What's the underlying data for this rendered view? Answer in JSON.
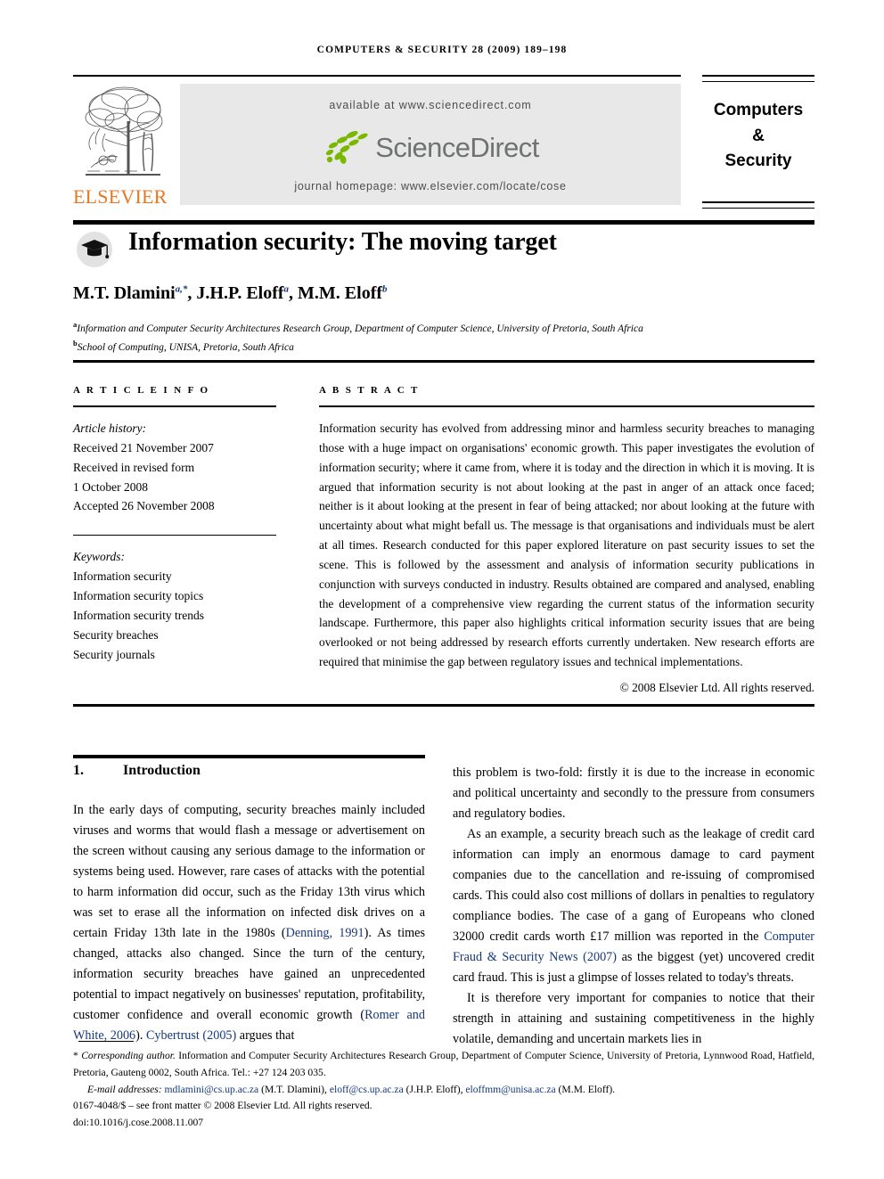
{
  "running_head": "COMPUTERS & SECURITY 28 (2009) 189–198",
  "masthead": {
    "available_at": "available at www.sciencedirect.com",
    "sciencedirect_wordmark": "ScienceDirect",
    "journal_homepage": "journal homepage: www.elsevier.com/locate/cose",
    "publisher_wordmark": "ELSEVIER",
    "publisher_logo_icon": "elsevier-tree-icon",
    "sciencedirect_logo_icon": "sciencedirect-leaves-icon"
  },
  "journal_box": {
    "line1": "Computers",
    "line2": "&",
    "line3": "Security"
  },
  "article": {
    "title": "Information security: The moving target",
    "title_icon": "graduation-cap-icon",
    "authors_plain": "M.T. Dlamini, J.H.P. Eloff, M.M. Eloff",
    "author1": "M.T. Dlamini",
    "author1_sup": "a,*",
    "author2": "J.H.P. Eloff",
    "author2_sup": "a",
    "author3": "M.M. Eloff",
    "author3_sup": "b",
    "affiliation_a_marker": "a",
    "affiliation_a": "Information and Computer Security Architectures Research Group, Department of Computer Science, University of Pretoria, South Africa",
    "affiliation_b_marker": "b",
    "affiliation_b": "School of Computing, UNISA, Pretoria, South Africa"
  },
  "article_info": {
    "label": "A R T I C L E  I N F O",
    "history_label": "Article history:",
    "history": [
      "Received 21 November 2007",
      "Received in revised form",
      "1 October 2008",
      "Accepted 26 November 2008"
    ],
    "keywords_label": "Keywords:",
    "keywords": [
      "Information security",
      "Information security topics",
      "Information security trends",
      "Security breaches",
      "Security journals"
    ]
  },
  "abstract": {
    "label": "A B S T R A C T",
    "text": "Information security has evolved from addressing minor and harmless security breaches to managing those with a huge impact on organisations' economic growth. This paper investigates the evolution of information security; where it came from, where it is today and the direction in which it is moving. It is argued that information security is not about looking at the past in anger of an attack once faced; neither is it about looking at the present in fear of being attacked; nor about looking at the future with uncertainty about what might befall us. The message is that organisations and individuals must be alert at all times. Research conducted for this paper explored literature on past security issues to set the scene. This is followed by the assessment and analysis of information security publications in conjunction with surveys conducted in industry. Results obtained are compared and analysed, enabling the development of a comprehensive view regarding the current status of the information security landscape. Furthermore, this paper also highlights critical information security issues that are being overlooked or not being addressed by research efforts currently undertaken. New research efforts are required that minimise the gap between regulatory issues and technical implementations.",
    "copyright": "© 2008 Elsevier Ltd. All rights reserved."
  },
  "section": {
    "number": "1.",
    "heading": "Introduction"
  },
  "body": {
    "left_p1_part1": "In the early days of computing, security breaches mainly included viruses and worms that would flash a message or advertisement on the screen without causing any serious damage to the information or systems being used. However, rare cases of attacks with the potential to harm information did occur, such as the Friday 13th virus which was set to erase all the information on infected disk drives on a certain Friday 13th late in the 1980s (",
    "cite_denning": "Denning, 1991",
    "left_p1_part2": "). As times changed, attacks also changed. Since the turn of the century, information security breaches have gained an unprecedented potential to impact negatively on businesses' reputation, profitability, customer confidence and overall economic growth (",
    "cite_romer": "Romer and White, 2006",
    "left_p1_part3": "). ",
    "cite_cybertrust": "Cybertrust (2005)",
    "left_p1_part4": " argues that",
    "right_p1": "this problem is two-fold: firstly it is due to the increase in economic and political uncertainty and secondly to the pressure from consumers and regulatory bodies.",
    "right_p2_part1": "As an example, a security breach such as the leakage of credit card information can imply an enormous damage to card payment companies due to the cancellation and re-issuing of compromised cards. This could also cost millions of dollars in penalties to regulatory compliance bodies. The case of a gang of Europeans who cloned 32000 credit cards worth £17 million was reported in the ",
    "cite_cfs": "Computer Fraud & Security News (2007)",
    "right_p2_part2": " as the biggest (yet) uncovered credit card fraud. This is just a glimpse of losses related to today's threats.",
    "right_p3": "It is therefore very important for companies to notice that their strength in attaining and sustaining competitiveness in the highly volatile, demanding and uncertain markets lies in"
  },
  "footnotes": {
    "corresponding_marker": "*",
    "corresponding_label": "Corresponding author.",
    "corresponding_text": " Information and Computer Security Architectures Research Group, Department of Computer Science, University of Pretoria, Lynnwood Road, Hatfield, Pretoria, Gauteng 0002, South Africa. Tel.: +27 124 203 035.",
    "email_label": "E-mail addresses:",
    "email1": "mdlamini@cs.up.ac.za",
    "email1_owner": " (M.T. Dlamini), ",
    "email2": "eloff@cs.up.ac.za",
    "email2_owner": " (J.H.P. Eloff), ",
    "email3": "eloffmm@unisa.ac.za",
    "email3_owner": " (M.M. Eloff).",
    "issn_line": "0167-4048/$ – see front matter © 2008 Elsevier Ltd. All rights reserved.",
    "doi_line": "doi:10.1016/j.cose.2008.11.007"
  }
}
